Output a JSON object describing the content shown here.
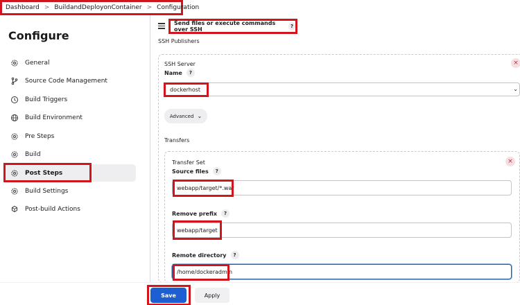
{
  "breadcrumb": {
    "items": [
      "Dashboard",
      "BuildandDeployonContainer",
      "Configuration"
    ],
    "separator": ">"
  },
  "sidebar": {
    "title": "Configure",
    "items": [
      {
        "label": "General",
        "icon": "gear-icon"
      },
      {
        "label": "Source Code Management",
        "icon": "branch-icon"
      },
      {
        "label": "Build Triggers",
        "icon": "clock-icon"
      },
      {
        "label": "Build Environment",
        "icon": "globe-icon"
      },
      {
        "label": "Pre Steps",
        "icon": "gear-icon"
      },
      {
        "label": "Build",
        "icon": "gear-icon"
      },
      {
        "label": "Post Steps",
        "icon": "gear-icon",
        "active": true
      },
      {
        "label": "Build Settings",
        "icon": "gear-icon"
      },
      {
        "label": "Post-build Actions",
        "icon": "cubes-icon"
      }
    ]
  },
  "main": {
    "section_title": "Send files or execute commands over SSH",
    "help_mark": "?",
    "ssh_publishers_label": "SSH Publishers",
    "ssh_server": {
      "heading": "SSH Server",
      "name_label": "Name",
      "name_value": "dockerhost",
      "advanced_label": "Advanced",
      "remove_symbol": "×"
    },
    "transfers_label": "Transfers",
    "transfer_set": {
      "heading": "Transfer Set",
      "source_files_label": "Source files",
      "source_files_value": "webapp/target/*.war",
      "remove_prefix_label": "Remove prefix",
      "remove_prefix_value": "webapp/target",
      "remote_directory_label": "Remote directory",
      "remote_directory_value": "/home/dockeradmin",
      "remove_symbol": "×"
    }
  },
  "footer": {
    "save_label": "Save",
    "apply_label": "Apply"
  },
  "colors": {
    "highlight": "#d0161c",
    "primary": "#1d5fd1"
  }
}
